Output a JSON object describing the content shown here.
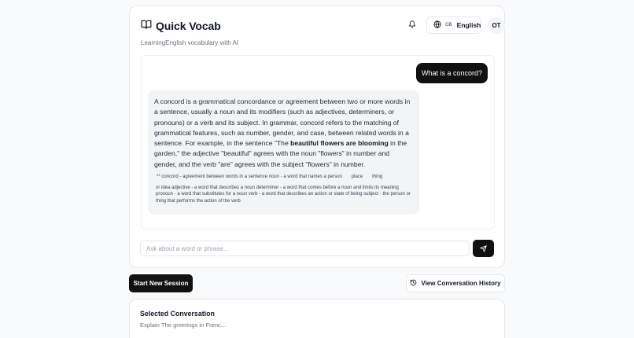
{
  "app": {
    "title": "Quick Vocab",
    "subtitle": "LearningEnglish vocabulary with AI"
  },
  "header": {
    "language": {
      "code": "GB",
      "name": "English"
    },
    "avatar_initials": "OT"
  },
  "chat": {
    "user_message": "What is a concord?",
    "bot_message": {
      "paragraph_before": "A concord is a grammatical concordance or agreement between two or more words in a sentence, usually a noun and its modifiers (such as adjectives, determiners, or pronouns) or a verb and its subject. In grammar, concord refers to the matching of grammatical features, such as number, gender, and case, between related words in a sentence. For example, in the sentence \"The ",
      "paragraph_bold": "beautiful flowers are blooming",
      "paragraph_after": " in the garden,\" the adjective \"beautiful\" agrees with the noun \"flowers\" in number and gender, and the verb \"are\" agrees with the subject \"flowers\" in number.",
      "glossary_line1_a": "** concord - agreement between words in a sentence noun - a word that names a person",
      "glossary_line1_b": "place",
      "glossary_line1_c": "thing",
      "glossary_line2": "or idea adjective - a word that describes a noun determiner - a word that comes before a noun and limits its meaning pronoun - a word that substitutes for a noun verb - a word that describes an action or state of being subject - the person or thing that performs the action of the verb"
    }
  },
  "input": {
    "placeholder": "Ask about a word or phrase...",
    "value": ""
  },
  "actions": {
    "new_session_label": "Start New Session",
    "history_label": "View Conversation History"
  },
  "selected": {
    "title": "Selected Conversation",
    "preview": "Explain The greetings in Frenc..."
  },
  "icons": {
    "brand": "book-open-icon",
    "bell": "bell-icon",
    "globe": "globe-icon",
    "send": "send-icon",
    "history": "history-icon"
  },
  "colors": {
    "primary": "#111111",
    "muted_text": "#6b7280",
    "bubble_bg": "#f3f4f6",
    "border": "#e5e7eb"
  }
}
